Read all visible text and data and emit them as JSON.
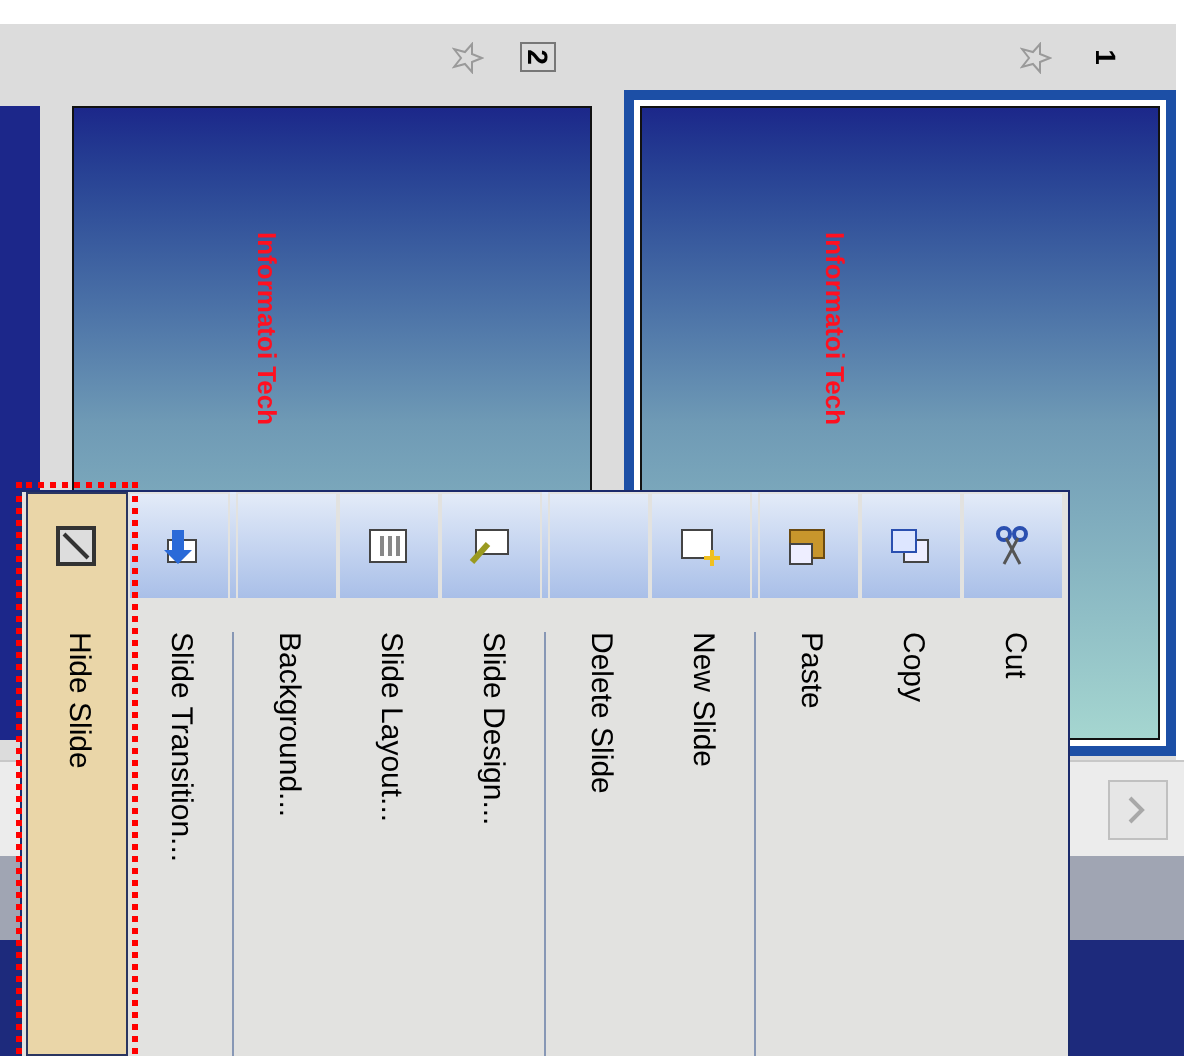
{
  "slides": [
    {
      "number": "1",
      "selected": true,
      "focused": false,
      "title": "Informatoi Tech"
    },
    {
      "number": "2",
      "selected": false,
      "focused": true,
      "title": "Informatoi Tech"
    }
  ],
  "context_menu": [
    {
      "kind": "item",
      "label": "Cut",
      "selected": false
    },
    {
      "kind": "item",
      "label": "Copy",
      "selected": false
    },
    {
      "kind": "item",
      "label": "Paste",
      "selected": false
    },
    {
      "kind": "separator"
    },
    {
      "kind": "item",
      "label": "New Slide",
      "selected": false
    },
    {
      "kind": "item",
      "label": "Delete Slide",
      "selected": false
    },
    {
      "kind": "separator"
    },
    {
      "kind": "item",
      "label": "Slide Design...",
      "selected": false
    },
    {
      "kind": "item",
      "label": "Slide Layout...",
      "selected": false
    },
    {
      "kind": "item",
      "label": "Background...",
      "selected": false
    },
    {
      "kind": "separator"
    },
    {
      "kind": "item",
      "label": "Slide Transition...",
      "selected": false
    },
    {
      "kind": "item",
      "label": "Hide Slide",
      "selected": true
    }
  ]
}
